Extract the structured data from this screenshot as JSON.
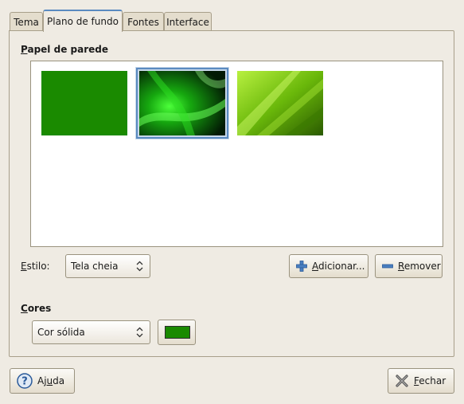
{
  "tabs": [
    {
      "label": "Tema"
    },
    {
      "label": "Plano de fundo"
    },
    {
      "label": "Fontes"
    },
    {
      "label": "Interface"
    }
  ],
  "wallpaper": {
    "title_mnemonic": "P",
    "title_rest": "apel de parede",
    "selected_index": 1
  },
  "style": {
    "label_mnemonic": "E",
    "label_rest": "stilo:",
    "value": "Tela cheia"
  },
  "add_button": {
    "mnemonic": "A",
    "rest": "dicionar..."
  },
  "remove_button": {
    "mnemonic": "R",
    "rest": "emover"
  },
  "colors": {
    "title_mnemonic": "C",
    "title_rest": "ores",
    "mode_value": "Cor sólida",
    "swatch_color": "#1a8a00"
  },
  "help_button": {
    "pre": "Aj",
    "mnemonic": "u",
    "post": "da"
  },
  "close_button": {
    "mnemonic": "F",
    "rest": "echar"
  },
  "colors_palette": {
    "accent": "#5a8ac0",
    "solid_green": "#1a8a00"
  }
}
